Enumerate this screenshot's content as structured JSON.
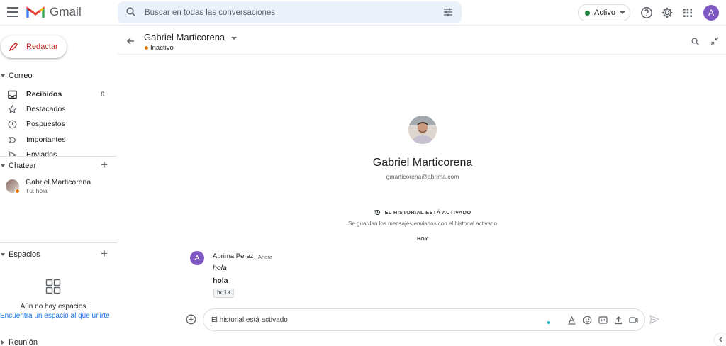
{
  "app": {
    "name": "Gmail"
  },
  "search": {
    "placeholder": "Buscar en todas las conversaciones"
  },
  "status": {
    "label": "Activo",
    "color": "#188038"
  },
  "account": {
    "initial": "A"
  },
  "compose": {
    "label": "Redactar"
  },
  "sidebar": {
    "mail_header": "Correo",
    "items": [
      {
        "label": "Recibidos",
        "count": "6",
        "icon": "inbox-icon",
        "active": true
      },
      {
        "label": "Destacados",
        "count": "",
        "icon": "star-icon"
      },
      {
        "label": "Pospuestos",
        "count": "",
        "icon": "clock-icon"
      },
      {
        "label": "Importantes",
        "count": "",
        "icon": "label-important-icon"
      },
      {
        "label": "Enviados",
        "count": "",
        "icon": "send-icon"
      }
    ],
    "chat_header": "Chatear",
    "chat": {
      "name": "Gabriel Marticorena",
      "preview": "Tú: hola",
      "status_color": "#e37400"
    },
    "spaces_header": "Espacios",
    "spaces_empty": "Aún no hay espacios",
    "spaces_link": "Encuentra un espacio al que unirte",
    "meet_header": "Reunión"
  },
  "conversation": {
    "name": "Gabriel Marticorena",
    "status": "Inactivo",
    "email": "gmarticorena@abrima.com",
    "history_title": "EL HISTORIAL ESTÁ ACTIVADO",
    "history_sub": "Se guardan los mensajes enviados con el historial activado",
    "day": "HOY",
    "message": {
      "avatar_initial": "A",
      "sender": "Abrima Perez",
      "time": "Ahora",
      "line1": "hola",
      "line2": "hola",
      "code": "hola"
    },
    "composer_placeholder": "El historial está activado"
  }
}
